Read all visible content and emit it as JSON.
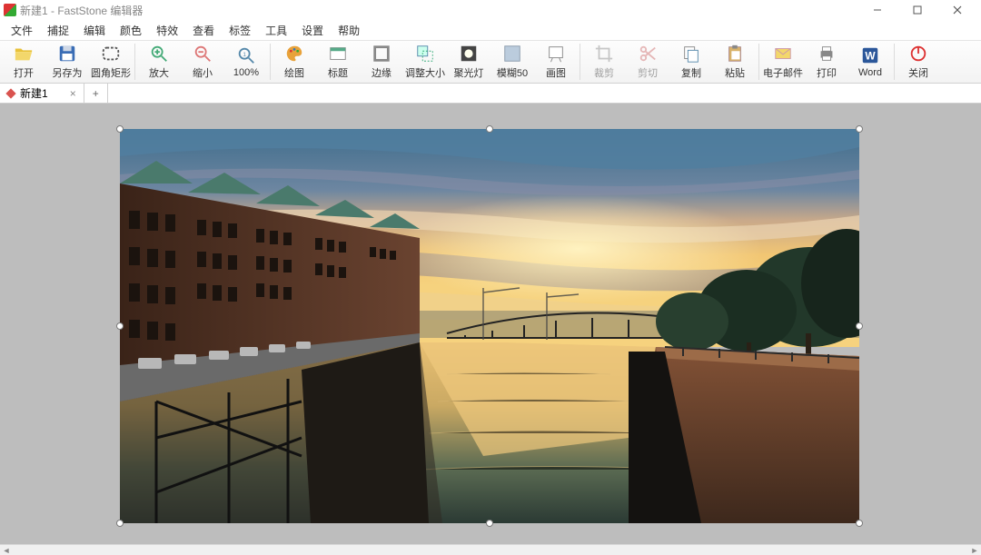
{
  "titlebar": {
    "title": "新建1 - FastStone 编辑器"
  },
  "menu": {
    "items": [
      "文件",
      "捕捉",
      "编辑",
      "颜色",
      "特效",
      "查看",
      "标签",
      "工具",
      "设置",
      "帮助"
    ]
  },
  "toolbar": {
    "groups": [
      [
        {
          "id": "open",
          "label": "打开",
          "icon": "folder-open-icon"
        },
        {
          "id": "saveas",
          "label": "另存为",
          "icon": "diskette-icon"
        },
        {
          "id": "roundrect",
          "label": "圆角矩形",
          "icon": "rounded-rect-icon"
        }
      ],
      [
        {
          "id": "zoomin",
          "label": "放大",
          "icon": "zoom-in-icon"
        },
        {
          "id": "zoomout",
          "label": "缩小",
          "icon": "zoom-out-icon"
        },
        {
          "id": "zoom100",
          "label": "100%",
          "icon": "zoom-100-icon"
        }
      ],
      [
        {
          "id": "draw",
          "label": "绘图",
          "icon": "palette-icon"
        },
        {
          "id": "caption",
          "label": "标题",
          "icon": "caption-icon"
        },
        {
          "id": "edge",
          "label": "边缘",
          "icon": "edge-icon"
        },
        {
          "id": "resize",
          "label": "调整大小",
          "icon": "resize-icon"
        },
        {
          "id": "spot",
          "label": "聚光灯",
          "icon": "spotlight-icon"
        },
        {
          "id": "blur",
          "label": "模糊50",
          "icon": "blur-icon"
        },
        {
          "id": "canvas",
          "label": "画图",
          "icon": "canvas-icon"
        }
      ],
      [
        {
          "id": "crop",
          "label": "裁剪",
          "icon": "crop-icon",
          "disabled": true
        },
        {
          "id": "cut",
          "label": "剪切",
          "icon": "scissors-icon",
          "disabled": true
        },
        {
          "id": "copy",
          "label": "复制",
          "icon": "copy-icon"
        },
        {
          "id": "paste",
          "label": "粘贴",
          "icon": "paste-icon"
        }
      ],
      [
        {
          "id": "email",
          "label": "电子邮件",
          "icon": "mail-icon"
        },
        {
          "id": "print",
          "label": "打印",
          "icon": "printer-icon"
        },
        {
          "id": "word",
          "label": "Word",
          "icon": "word-icon"
        }
      ],
      [
        {
          "id": "close",
          "label": "关闭",
          "icon": "power-icon"
        }
      ]
    ]
  },
  "tabs": {
    "items": [
      {
        "label": "新建1",
        "dirty": true
      }
    ],
    "add_label": "+"
  },
  "image": {
    "description": "Sunset over a canal with historic brick warehouse buildings (Speicherstadt-style), an arched iron bridge, trees on the right bank, reflections of orange and blue sky on calm water.",
    "colors": {
      "sky_top": "#3f6d8c",
      "sky_mid": "#e7b463",
      "sky_low": "#f4c773",
      "cloud_hi": "#f0d7b7",
      "cloud_sh": "#6a6c86",
      "water_hi": "#e9b96a",
      "water_lo": "#3a4a44",
      "brick": "#5a3a2b",
      "brick_sh": "#2f1f18",
      "roof": "#4a7a6c",
      "bridge": "#2a2a2a",
      "tree_dk": "#16251c",
      "tree_md": "#2b4a34",
      "wall_r": "#7a4a32",
      "road": "#5b5b5b"
    }
  }
}
